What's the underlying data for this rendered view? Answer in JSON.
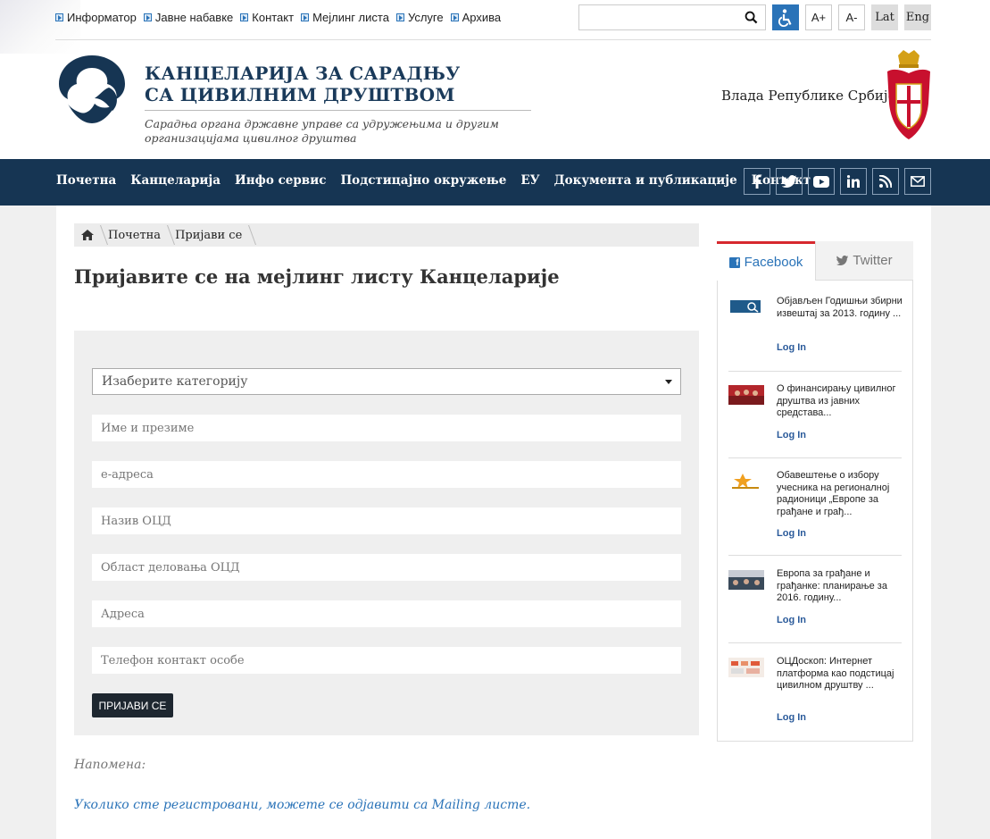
{
  "topbar": {
    "links": [
      "Информатор",
      "Јавне набавке",
      "Контакт",
      "Мејлинг листа",
      "Услуге",
      "Архива"
    ],
    "search_placeholder": "",
    "font_increase": "A+",
    "font_decrease": "A-",
    "lang_lat": "Lat",
    "lang_eng": "Eng"
  },
  "header": {
    "org_line1": "КАНЦЕЛАРИЈА ЗА САРАДЊУ",
    "org_line2": "СА ЦИВИЛНИМ ДРУШТВОМ",
    "subtitle": "Сарадња органа државне управе са удружењима и другим организацијама цивилног друштва",
    "government": "Влада Републике Србије"
  },
  "nav": {
    "items": [
      "Почетна",
      "Канцеларија",
      "Инфо сервис",
      "Подстицајно окружење",
      "ЕУ",
      "Документа и публикације",
      "Контакт"
    ],
    "social": [
      "f",
      "t",
      "yt",
      "in",
      "rss",
      "mail"
    ]
  },
  "breadcrumb": {
    "items": [
      "Почетна",
      "Пријави се"
    ]
  },
  "page": {
    "title": "Пријавите се на мејлинг листу Канцеларије",
    "select_placeholder": "Изаберите категорију",
    "fields": [
      "Име и презиме",
      "е-адреса",
      "Назив ОЦД",
      "Област деловања ОЦД",
      "Адреса",
      "Телефон контакт особе"
    ],
    "submit": "ПРИЈАВИ СЕ",
    "note": "Напомена:",
    "unsubscribe": "Уколико сте регистровани, можете се одјавити са Mailing листе."
  },
  "sidebar": {
    "tab_facebook": "Facebook",
    "tab_twitter": "Twitter",
    "posts": [
      {
        "text": "Објављен Годишњи збирни извештај за 2013. годину ...",
        "login": "Log In"
      },
      {
        "text": "О финансирању цивилног друштва из јавних средстава...",
        "login": "Log In"
      },
      {
        "text": "Обавештење о избору учесника на регионалној радионици „Европе за грађане и грађ...",
        "login": "Log In"
      },
      {
        "text": "Европа за грађане и грађанке: планирање за 2016. годину...",
        "login": "Log In"
      },
      {
        "text": "ОЦДоскоп: Интернет платформа као подстицај цивилном друштву ...",
        "login": "Log In"
      }
    ]
  },
  "colors": {
    "nav_bg": "#163553",
    "accent": "#2a73b8",
    "fb_tab": "#d6282e"
  }
}
